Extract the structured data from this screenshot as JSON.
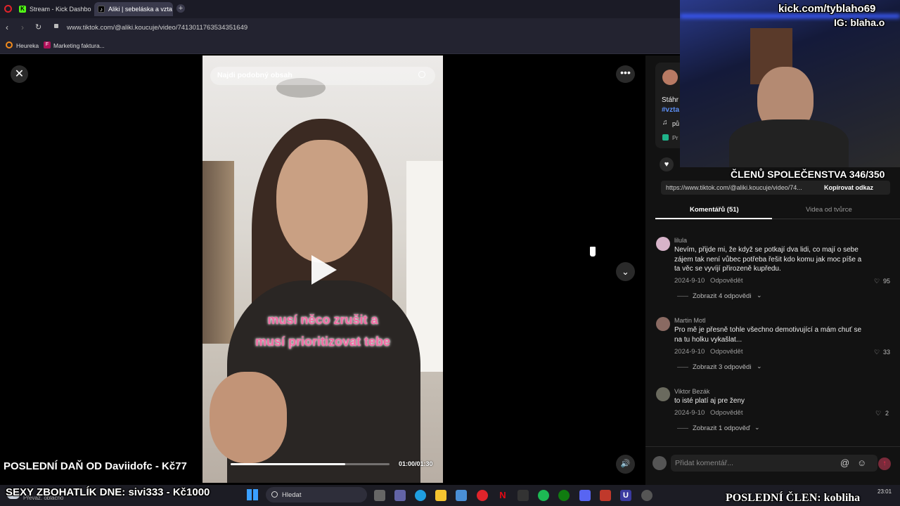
{
  "browser": {
    "tabs": [
      {
        "label": "Stream - Kick Dashboard",
        "active": false
      },
      {
        "label": "Aliki | sebeláska a vzta",
        "active": true
      }
    ],
    "url": "www.tiktok.com/@aliki.koucuje/video/7413011763534351649",
    "bookmarks": [
      "Heureka",
      "Marketing faktura..."
    ]
  },
  "video": {
    "search_placeholder": "Najdi podobný obsah",
    "caption_line1": "musí něco zrušit a",
    "caption_line2": "musí prioritizovat tebe",
    "time": "01:00/01:30",
    "progress": 0.72
  },
  "panel": {
    "desc_partial": "Stáhr",
    "hashtag_partial": "#vzta",
    "music_partial": "pů",
    "extra_partial": "Pr",
    "copy_url": "https://www.tiktok.com/@aliki.koucuje/video/74...",
    "copy_button": "Kopírovat odkaz",
    "tabs": [
      "Komentářů (51)",
      "Videa od tvůrce"
    ],
    "comments": [
      {
        "user": "lilula",
        "text": "Nevím, přijde mi, že když se potkají dva lidi, co mají o sebe zájem tak není vůbec potřeba řešit kdo komu jak moc píše a ta věc se vyvíjí přirozeně kupředu.",
        "date": "2024-9-10",
        "reply": "Odpovědět",
        "likes": "95",
        "more": "Zobrazit 4 odpovědi"
      },
      {
        "user": "Martin Motl",
        "text": "Pro mě je přesně tohle všechno demotivující a mám chuť se na tu holku vykašlat...",
        "date": "2024-9-10",
        "reply": "Odpovědět",
        "likes": "33",
        "more": "Zobrazit 3 odpovědi"
      },
      {
        "user": "Viktor Bezák",
        "text": "to isté platí aj pre ženy",
        "date": "2024-9-10",
        "reply": "Odpovědět",
        "likes": "2",
        "more": "Zobrazit 1 odpověď"
      }
    ],
    "add_comment_placeholder": "Přidat komentář..."
  },
  "stream_overlay": {
    "kick_url": "kick.com/tyblaho69",
    "ig": "IG: blaha.o",
    "members": "ČLENŮ SPOLEČENSTVA 346/350",
    "last_tax": "POSLEDNÍ DAŇ OD Daviidofc - Kč77",
    "sexy": "SEXY ZBOHATLÍK DNE: sivi333 - Kč1000",
    "last_member": "POSLEDNÍ ČLEN: kobliha"
  },
  "taskbar": {
    "weather": "Převáž. oblačno",
    "search": "Hledat",
    "time": "23:01"
  },
  "colors": {
    "accent_red": "#fe2c55",
    "caption_pink": "#f26ba3"
  }
}
